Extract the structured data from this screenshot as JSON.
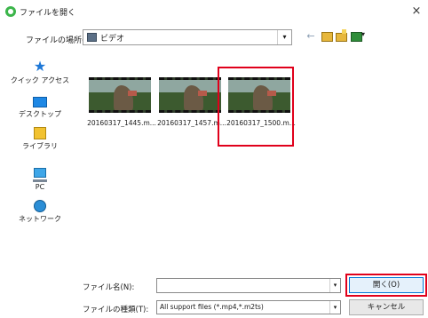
{
  "window": {
    "title": "ファイルを開く",
    "close": "×"
  },
  "location": {
    "label": "ファイルの場所(I):",
    "value": "ビデオ",
    "dropdown": "▾"
  },
  "toolbar": {
    "back": "←"
  },
  "places": [
    {
      "label": "クイック アクセス",
      "icon": "star-icon"
    },
    {
      "label": "デスクトップ",
      "icon": "desktop-icon"
    },
    {
      "label": "ライブラリ",
      "icon": "library-icon"
    },
    {
      "label": "PC",
      "icon": "pc-icon"
    },
    {
      "label": "ネットワーク",
      "icon": "network-icon"
    }
  ],
  "files": [
    {
      "name": "20160317_1445.m..."
    },
    {
      "name": "20160317_1457.m..."
    },
    {
      "name": "20160317_1500.m..."
    }
  ],
  "bottom": {
    "filename_label": "ファイル名(N):",
    "filename_value": "",
    "filetype_label": "ファイルの種類(T):",
    "filetype_value": "All support files (*.mp4,*.m2ts)",
    "dropdown": "▾",
    "open_button": "開く(O)",
    "cancel_button": "キャンセル"
  },
  "highlight_color": "#e0001b",
  "accent_color": "#0078d7"
}
